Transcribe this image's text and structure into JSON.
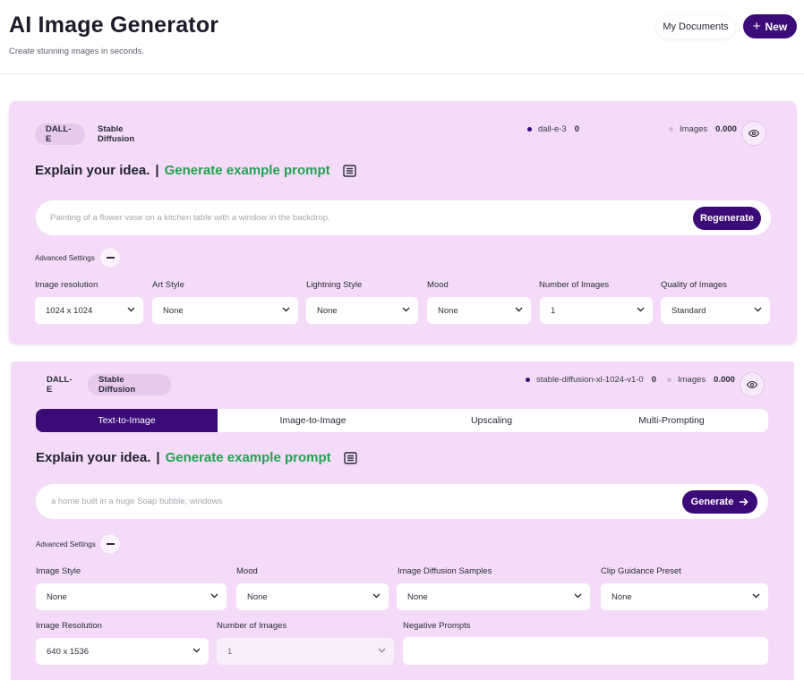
{
  "header": {
    "title": "AI Image Generator",
    "subtitle": "Create stunning images in seconds.",
    "my_documents_label": "My Documents",
    "new_label": "New"
  },
  "panel1": {
    "tabs": [
      "DALL-E",
      "Stable Diffusion"
    ],
    "active_tab": "DALL-E",
    "stats": [
      {
        "label": "dall-e-3",
        "value": "0"
      },
      {
        "label": "Images",
        "value": "0.000"
      }
    ],
    "explain_text": "Explain your idea.",
    "separator": "|",
    "example_prompt_link": "Generate example prompt",
    "prompt_placeholder": "Painting of a flower vase on a kitchen table with a window in the backdrop.",
    "action_label": "Regenerate",
    "advanced_settings_label": "Advanced Settings",
    "fields": [
      {
        "label": "Image resolution",
        "value": "1024 x 1024"
      },
      {
        "label": "Art Style",
        "value": "None"
      },
      {
        "label": "Lightning Style",
        "value": "None"
      },
      {
        "label": "Mood",
        "value": "None"
      },
      {
        "label": "Number of Images",
        "value": "1"
      },
      {
        "label": "Quality of Images",
        "value": "Standard"
      }
    ]
  },
  "panel2": {
    "tabs": [
      "DALL-E",
      "Stable Diffusion"
    ],
    "active_tab": "Stable Diffusion",
    "stats": [
      {
        "label": "stable-diffusion-xl-1024-v1-0",
        "value": "0"
      },
      {
        "label": "Images",
        "value": "0.000"
      }
    ],
    "modes": [
      "Text-to-Image",
      "Image-to-Image",
      "Upscaling",
      "Multi-Prompting"
    ],
    "active_mode": "Text-to-Image",
    "explain_text": "Explain your idea.",
    "separator": "|",
    "example_prompt_link": "Generate example prompt",
    "prompt_placeholder": "a home built in a huge Soap bubble, windows",
    "action_label": "Generate",
    "advanced_settings_label": "Advanced Settings",
    "fields_row1": [
      {
        "label": "Image Style",
        "value": "None"
      },
      {
        "label": "Mood",
        "value": "None"
      },
      {
        "label": "Image Diffusion Samples",
        "value": "None"
      },
      {
        "label": "Clip Guidance Preset",
        "value": "None"
      }
    ],
    "fields_row2": [
      {
        "label": "Image Resolution",
        "value": "640 x 1536"
      },
      {
        "label": "Number of Images",
        "value": "1"
      }
    ],
    "negative_prompts_label": "Negative Prompts",
    "negative_prompts_value": ""
  },
  "colors": {
    "brand": "#3b0b78",
    "panel_bg": "#f4dcf8",
    "link_green": "#22a24f"
  }
}
